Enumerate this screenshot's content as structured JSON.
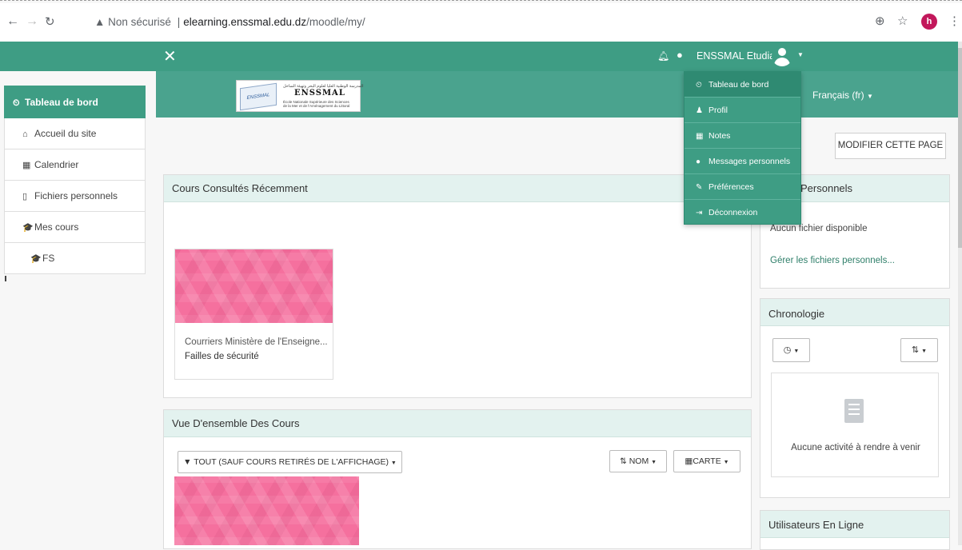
{
  "browser": {
    "security": "Non sécurisé",
    "url_host": "elearning.enssmal.edu.dz",
    "url_path": "/moodle/my/",
    "profile_initial": "h"
  },
  "topnav": {
    "close_icon": "✕",
    "username": "ENSSMAL Etudiant"
  },
  "sidebar": {
    "items": [
      {
        "label": "Tableau de bord",
        "icon": "dashboard-icon",
        "glyph": "⏲"
      },
      {
        "label": "Accueil du site",
        "icon": "home-icon",
        "glyph": "⌂"
      },
      {
        "label": "Calendrier",
        "icon": "calendar-icon",
        "glyph": "▦"
      },
      {
        "label": "Fichiers personnels",
        "icon": "file-icon",
        "glyph": "▯"
      },
      {
        "label": "Mes cours",
        "icon": "graduation-cap-icon",
        "glyph": "🎓"
      },
      {
        "label": "FS",
        "icon": "graduation-cap-icon",
        "glyph": "🎓"
      }
    ]
  },
  "header": {
    "logo_name": "ENSSMAL",
    "language": "Français (fr)"
  },
  "modify_button": "MODIFIER CETTE PAGE",
  "user_menu": {
    "items": [
      {
        "label": "Tableau de bord",
        "glyph": "⏲"
      },
      {
        "label": "Profil",
        "glyph": "♟"
      },
      {
        "label": "Notes",
        "glyph": "▦"
      },
      {
        "label": "Messages personnels",
        "glyph": "●"
      },
      {
        "label": "Préférences",
        "glyph": "✎"
      },
      {
        "label": "Déconnexion",
        "glyph": "⇥"
      }
    ]
  },
  "recent": {
    "title": "Cours Consultés Récemment",
    "course_category": "Courriers Ministère de l'Enseigne...",
    "course_name": "Failles de sécurité"
  },
  "overview": {
    "title": "Vue D'ensemble Des Cours",
    "filter": "TOUT (SAUF COURS RETIRÉS DE L'AFFICHAGE)",
    "sort": "NOM",
    "view": "CARTE"
  },
  "private_files": {
    "title": "Personnels",
    "empty": "Aucun fichier disponible",
    "manage_link": "Gérer les fichiers personnels..."
  },
  "timeline": {
    "title": "Chronologie",
    "empty": "Aucune activité à rendre à venir"
  },
  "online_users": {
    "title": "Utilisateurs En Ligne"
  },
  "colors": {
    "brand": "#3e9d84",
    "course_image": "#f5709e"
  }
}
